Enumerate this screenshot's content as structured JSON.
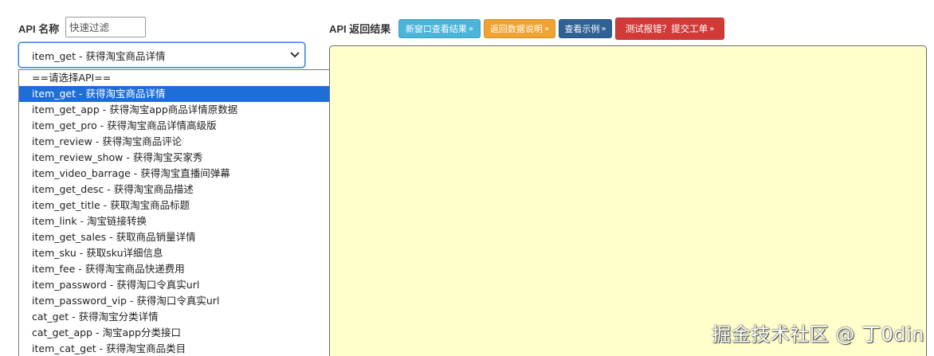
{
  "filter": {
    "label": "API 名称",
    "placeholder": "快速过滤"
  },
  "select": {
    "value": "item_get - 获得淘宝商品详情"
  },
  "dropdown": {
    "options": [
      "==请选择API==",
      "item_get - 获得淘宝商品详情",
      "item_get_app - 获得淘宝app商品详情原数据",
      "item_get_pro - 获得淘宝商品详情高级版",
      "item_review - 获得淘宝商品评论",
      "item_review_show - 获得淘宝买家秀",
      "item_video_barrage - 获得淘宝直播间弹幕",
      "item_get_desc - 获得淘宝商品描述",
      "item_get_title - 获取淘宝商品标题",
      "item_link - 淘宝链接转换",
      "item_get_sales - 获取商品销量详情",
      "item_sku - 获取sku详细信息",
      "item_fee - 获得淘宝商品快递费用",
      "item_password - 获得淘口令真实url",
      "item_password_vip - 获得淘口令真实url",
      "cat_get - 获得淘宝分类详情",
      "cat_get_app - 淘宝app分类接口",
      "item_cat_get - 获得淘宝商品类目"
    ],
    "selected_index": 1
  },
  "result": {
    "label": "API 返回结果",
    "buttons": {
      "new_window": "新窗口查看结果",
      "data_doc": "返回数据说明",
      "example": "查看示例",
      "report": "测试报错？提交工单"
    },
    "arrow": "»"
  },
  "watermark": "掘金技术社区 @ 丁0din",
  "colors": {
    "selected_bg": "#1e6ed8",
    "result_bg": "#ffffcc",
    "btn_cyan": "#4bb5d9",
    "btn_orange": "#f0a330",
    "btn_navy": "#2f6194",
    "btn_red": "#d23a38"
  }
}
